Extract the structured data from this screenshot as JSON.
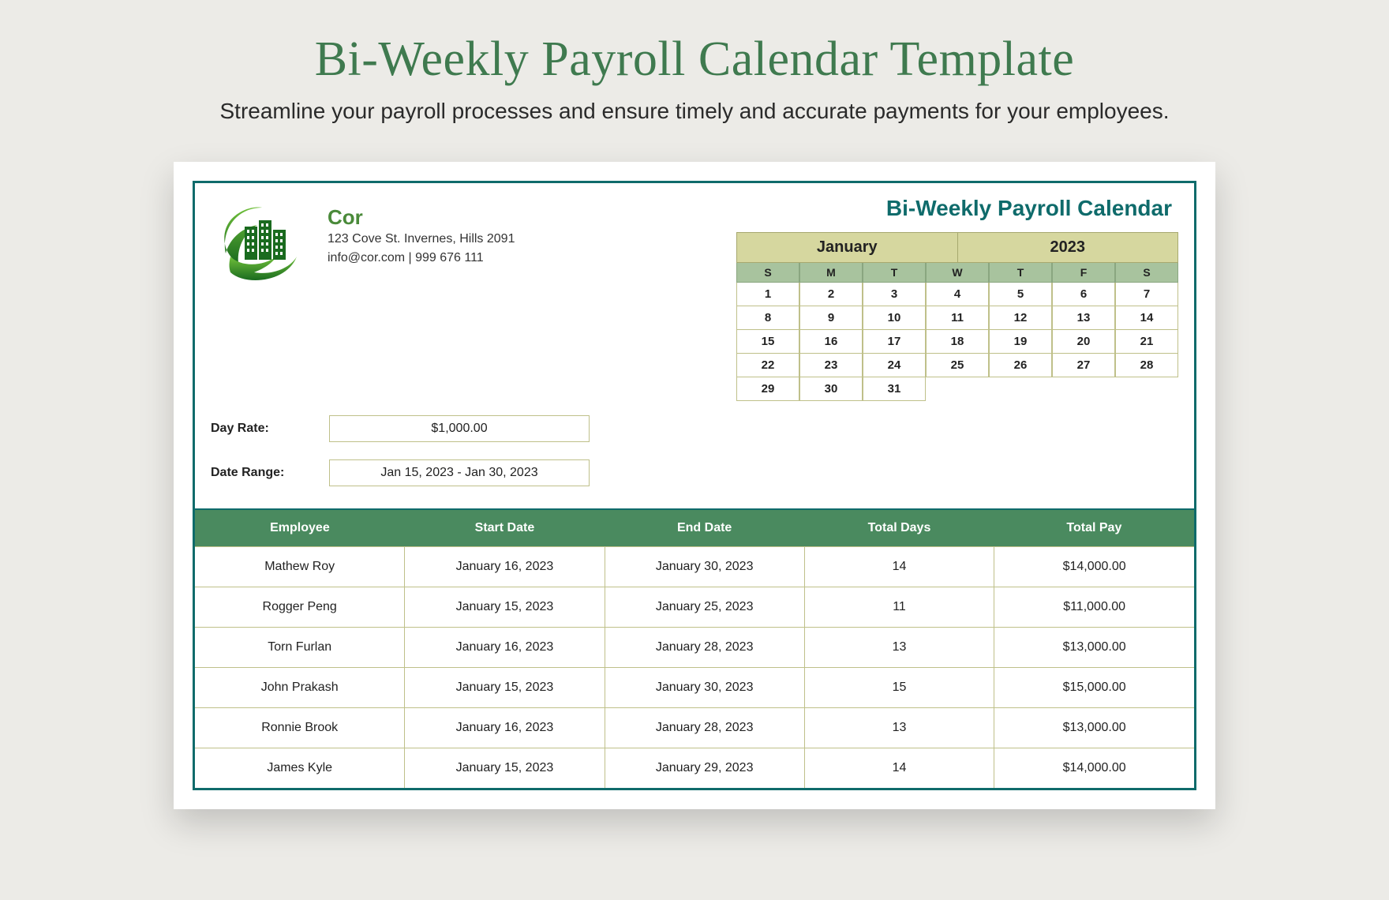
{
  "hero": {
    "title": "Bi-Weekly Payroll Calendar Template",
    "subtitle": "Streamline your payroll processes and ensure timely and accurate payments for your employees."
  },
  "company": {
    "name": "Cor",
    "address": "123 Cove St. Invernes, Hills 2091",
    "contact": "info@cor.com | 999 676 111"
  },
  "calendar": {
    "title": "Bi-Weekly Payroll Calendar",
    "month": "January",
    "year": "2023",
    "dow": [
      "S",
      "M",
      "T",
      "W",
      "T",
      "F",
      "S"
    ],
    "days": [
      "1",
      "2",
      "3",
      "4",
      "5",
      "6",
      "7",
      "8",
      "9",
      "10",
      "11",
      "12",
      "13",
      "14",
      "15",
      "16",
      "17",
      "18",
      "19",
      "20",
      "21",
      "22",
      "23",
      "24",
      "25",
      "26",
      "27",
      "28",
      "29",
      "30",
      "31",
      "",
      "",
      "",
      ""
    ]
  },
  "fields": {
    "day_rate_label": "Day Rate:",
    "day_rate_value": "$1,000.00",
    "date_range_label": "Date Range:",
    "date_range_value": "Jan 15, 2023 - Jan 30, 2023"
  },
  "table": {
    "headers": {
      "employee": "Employee",
      "start": "Start Date",
      "end": "End Date",
      "days": "Total Days",
      "pay": "Total Pay"
    },
    "rows": [
      {
        "employee": "Mathew Roy",
        "start": "January 16, 2023",
        "end": "January 30, 2023",
        "days": "14",
        "pay": "$14,000.00"
      },
      {
        "employee": "Rogger Peng",
        "start": "January 15, 2023",
        "end": "January 25, 2023",
        "days": "11",
        "pay": "$11,000.00"
      },
      {
        "employee": "Torn Furlan",
        "start": "January 16, 2023",
        "end": "January 28, 2023",
        "days": "13",
        "pay": "$13,000.00"
      },
      {
        "employee": "John Prakash",
        "start": "January 15, 2023",
        "end": "January 30, 2023",
        "days": "15",
        "pay": "$15,000.00"
      },
      {
        "employee": "Ronnie Brook",
        "start": "January 16, 2023",
        "end": "January 28, 2023",
        "days": "13",
        "pay": "$13,000.00"
      },
      {
        "employee": "James Kyle",
        "start": "January 15, 2023",
        "end": "January 29, 2023",
        "days": "14",
        "pay": "$14,000.00"
      }
    ]
  }
}
